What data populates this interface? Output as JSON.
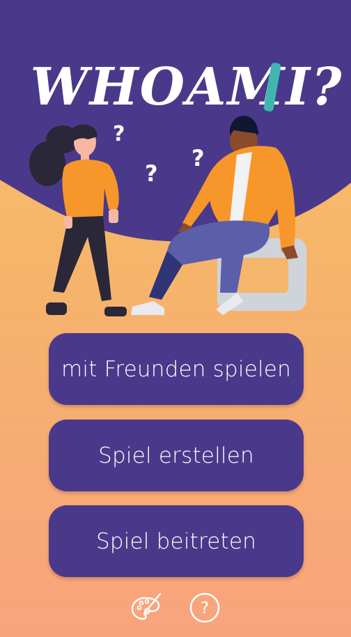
{
  "app": {
    "logo_text": "WHOAMI?"
  },
  "menu": {
    "play_with_friends": "mit Freunden spielen",
    "create_game": "Spiel erstellen",
    "join_game": "Spiel beitreten"
  },
  "footer": {
    "icons": [
      "paint-palette-icon",
      "help-icon"
    ]
  },
  "colors": {
    "primary_purple": "#4a398a",
    "accent_teal": "#3fb7b0",
    "bg_top": "#f9c26c",
    "bg_bottom": "#f8a37d",
    "jacket_orange": "#f7962a"
  }
}
